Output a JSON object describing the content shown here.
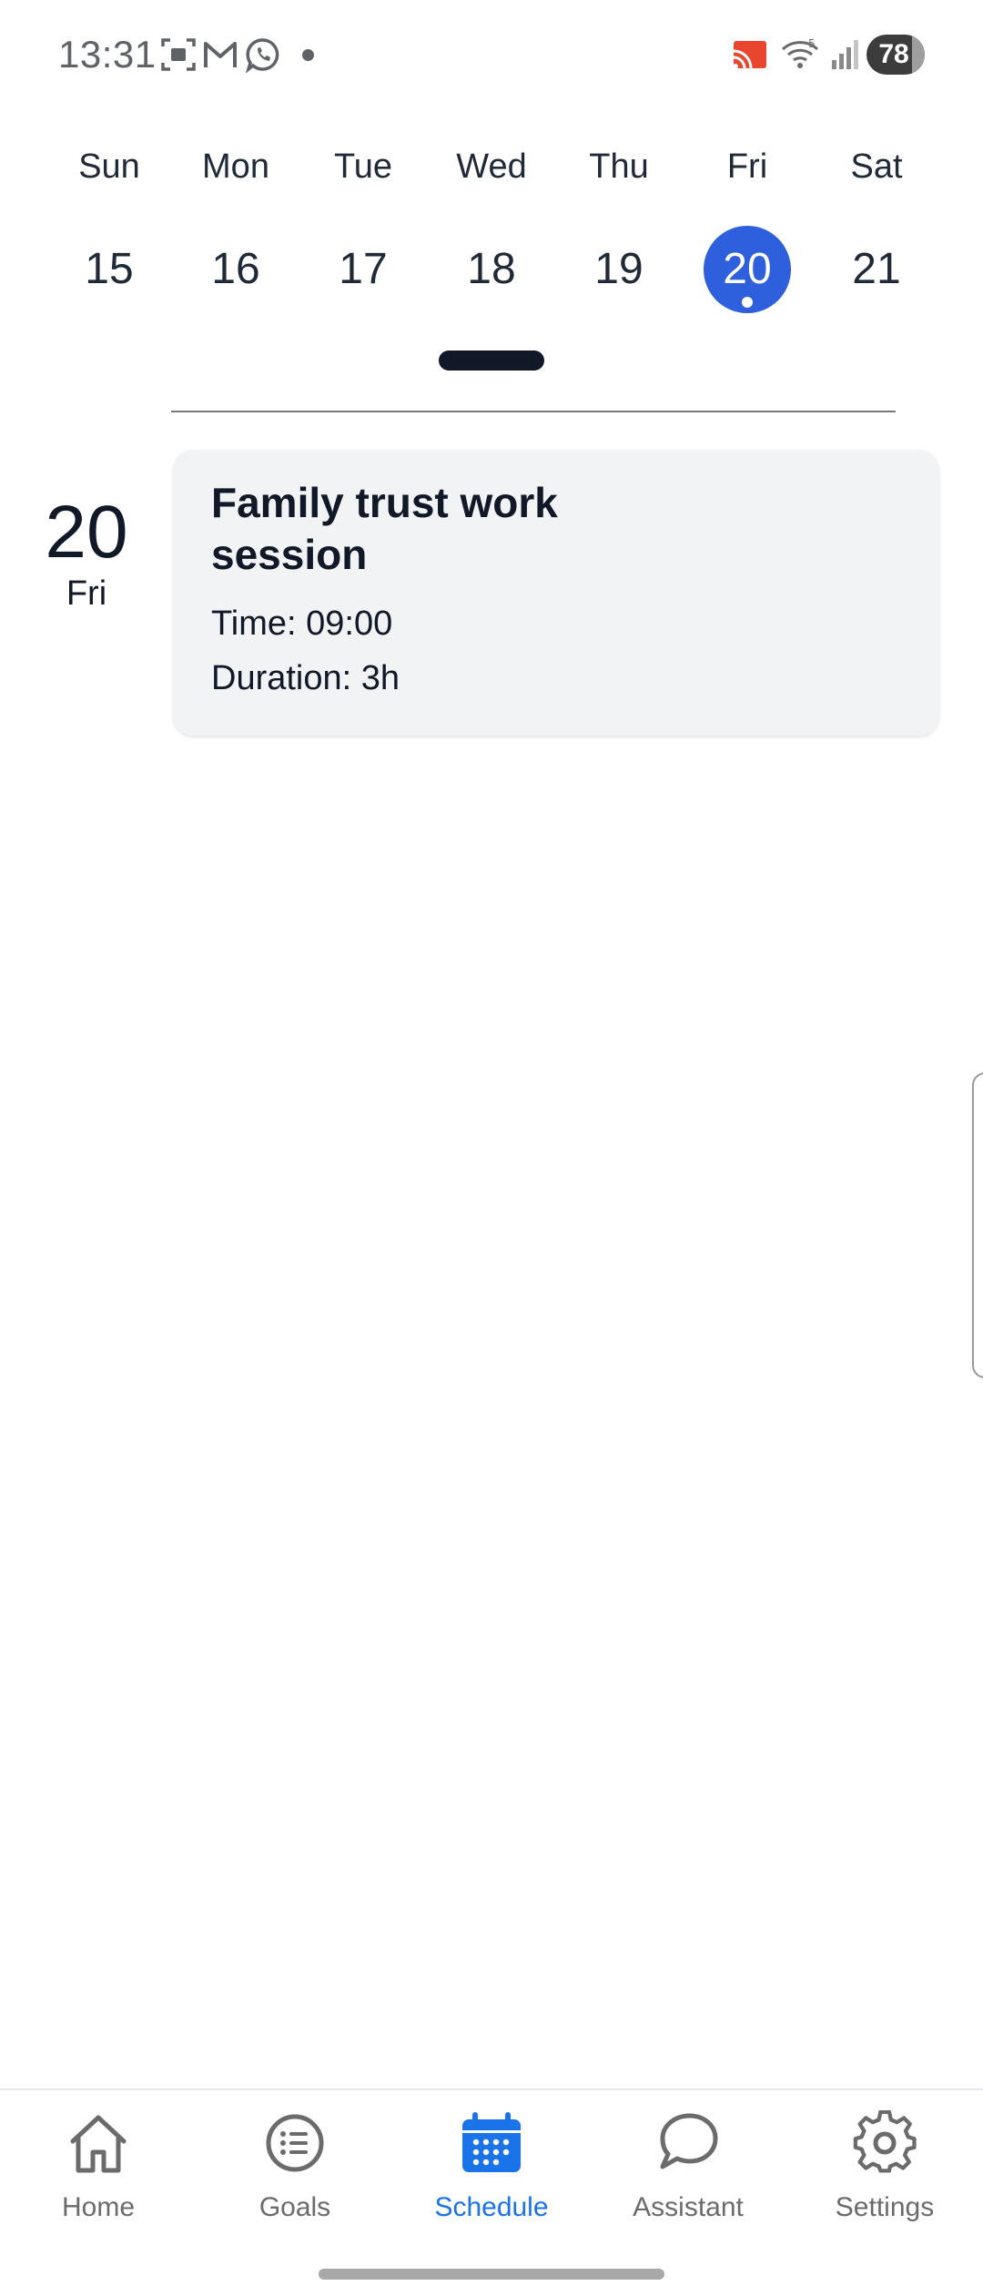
{
  "status_bar": {
    "time": "13:31",
    "battery": "78",
    "icons": [
      "screen-record-icon",
      "gmail-icon",
      "whatsapp-icon",
      "notification-dot",
      "cast-icon",
      "wifi-icon",
      "signal-icon",
      "battery-icon"
    ]
  },
  "week": {
    "days": [
      {
        "name": "Sun",
        "num": "15"
      },
      {
        "name": "Mon",
        "num": "16"
      },
      {
        "name": "Tue",
        "num": "17"
      },
      {
        "name": "Wed",
        "num": "18"
      },
      {
        "name": "Thu",
        "num": "19"
      },
      {
        "name": "Fri",
        "num": "20",
        "selected": true,
        "has_event": true
      },
      {
        "name": "Sat",
        "num": "21"
      }
    ]
  },
  "agenda": {
    "date_num": "20",
    "date_day": "Fri",
    "events": [
      {
        "title": "Family trust work session",
        "time": "Time: 09:00",
        "duration": "Duration: 3h"
      }
    ]
  },
  "nav": {
    "items": [
      {
        "label": "Home",
        "icon": "home-icon"
      },
      {
        "label": "Goals",
        "icon": "list-icon"
      },
      {
        "label": "Schedule",
        "icon": "calendar-icon",
        "active": true
      },
      {
        "label": "Assistant",
        "icon": "chat-bubble-icon"
      },
      {
        "label": "Settings",
        "icon": "gear-icon"
      }
    ]
  },
  "colors": {
    "accent": "#2e5fdc",
    "nav_active": "#1a73e8",
    "card_bg": "#f1f3f5"
  }
}
